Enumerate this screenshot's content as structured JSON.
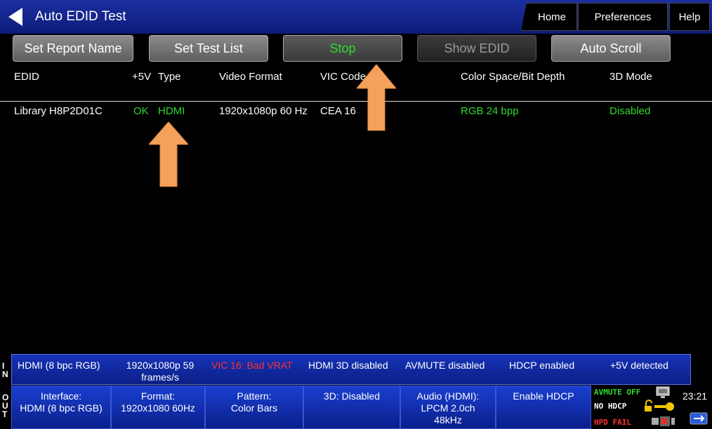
{
  "window": {
    "title": "Auto EDID Test"
  },
  "nav_tabs": {
    "home": "Home",
    "preferences": "Preferences",
    "help": "Help"
  },
  "toolbar": {
    "set_report_name": "Set Report Name",
    "set_test_list": "Set Test List",
    "stop": "Stop",
    "show_edid": "Show EDID",
    "auto_scroll": "Auto Scroll"
  },
  "table": {
    "headers": {
      "edid": "EDID",
      "plus5v": "+5V",
      "type": "Type",
      "video_format": "Video Format",
      "vic_code": "VIC Code",
      "color_space": "Color Space/Bit Depth",
      "mode_3d": "3D Mode"
    },
    "rows": [
      {
        "edid": "Library H8P2D01C",
        "plus5v": "OK",
        "type": "HDMI",
        "video_format": "1920x1080p 60 Hz",
        "vic_code": "CEA 16",
        "color_space": "RGB 24 bpp",
        "mode_3d": "Disabled"
      }
    ]
  },
  "in_status": {
    "letters": [
      "I",
      "N"
    ],
    "interface": "HDMI (8 bpc RGB)",
    "format_line1": "1920x1080p 59",
    "format_line2": "frames/s",
    "vic": "VIC 16: Bad VRAT",
    "hdmi3d": "HDMI 3D disabled",
    "avmute": "AVMUTE disabled",
    "hdcp": "HDCP enabled",
    "plus5v": "+5V detected"
  },
  "out_status": {
    "letters": [
      "O",
      "U",
      "T"
    ],
    "interface_label": "Interface:",
    "interface_value": "HDMI (8 bpc RGB)",
    "format_label": "Format:",
    "format_value": "1920x1080 60Hz",
    "pattern_label": "Pattern:",
    "pattern_value": "Color Bars",
    "mode_3d": "3D: Disabled",
    "audio_label": "Audio (HDMI):",
    "audio_value1": "LPCM 2.0ch",
    "audio_value2": "48kHz",
    "enable_hdcp": "Enable HDCP"
  },
  "indicators": {
    "avmute": "AVMUTE OFF",
    "hdcp": "NO HDCP",
    "hpd": "HPD FAIL"
  },
  "clock": "23:21",
  "colors": {
    "title_blue": "#1b2ea0",
    "status_green": "#2ed82e",
    "error_red": "#ff3030",
    "arrow_orange": "#f5a15c"
  }
}
